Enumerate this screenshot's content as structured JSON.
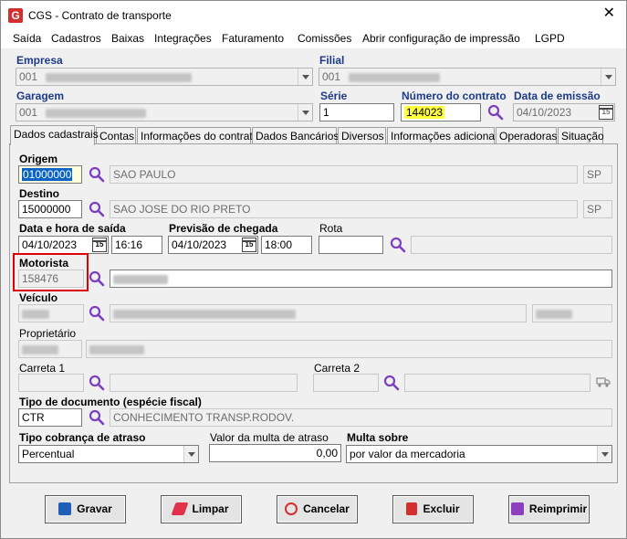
{
  "window": {
    "title": "CGS - Contrato de transporte",
    "logo_letter": "G",
    "close": "✕"
  },
  "menu": [
    "Saída",
    "Cadastros",
    "Baixas",
    "Integrações",
    "Faturamento",
    "Comissões",
    "Abrir configuração de impressão",
    "LGPD"
  ],
  "header": {
    "empresa_label": "Empresa",
    "empresa_code": "001",
    "filial_label": "Filial",
    "filial_code": "001",
    "garagem_label": "Garagem",
    "garagem_code": "001",
    "serie_label": "Série",
    "serie_value": "1",
    "numero_label": "Número do contrato",
    "numero_value": "144023",
    "data_emissao_label": "Data de emissão",
    "data_emissao_value": "04/10/2023"
  },
  "tabs": [
    "Dados cadastrais",
    "Contas",
    "Informações do contrato",
    "Dados Bancários",
    "Diversos",
    "Informações adicionais",
    "Operadoras",
    "Situação"
  ],
  "form": {
    "origem_label": "Origem",
    "origem_code": "01000000",
    "origem_city": "SAO PAULO",
    "origem_uf": "SP",
    "destino_label": "Destino",
    "destino_code": "15000000",
    "destino_city": "SAO JOSE DO RIO PRETO",
    "destino_uf": "SP",
    "saida_label": "Data e hora de saída",
    "saida_date": "04/10/2023",
    "saida_time": "16:16",
    "chegada_label": "Previsão de chegada",
    "chegada_date": "04/10/2023",
    "chegada_time": "18:00",
    "rota_label": "Rota",
    "motorista_label": "Motorista",
    "motorista_code": "158476",
    "veiculo_label": "Veículo",
    "proprietario_label": "Proprietário",
    "carreta1_label": "Carreta 1",
    "carreta2_label": "Carreta 2",
    "tipo_doc_label": "Tipo de documento (espécie fiscal)",
    "tipo_doc_code": "CTR",
    "tipo_doc_desc": "CONHECIMENTO TRANSP.RODOV.",
    "cobranca_label": "Tipo cobrança de atraso",
    "cobranca_value": "Percentual",
    "multa_valor_label": "Valor da multa de atraso",
    "multa_valor": "0,00",
    "multa_sobre_label": "Multa sobre",
    "multa_sobre_value": "por valor da mercadoria"
  },
  "buttons": {
    "gravar": "Gravar",
    "limpar": "Limpar",
    "cancelar": "Cancelar",
    "excluir": "Excluir",
    "reimprimir": "Reimprimir"
  },
  "colors": {
    "accent": "#1b3a8a",
    "highlight": "#ffff3b",
    "selection": "#0a64c8",
    "annotation": "#e00000",
    "search_icon": "#7b3fbf"
  }
}
